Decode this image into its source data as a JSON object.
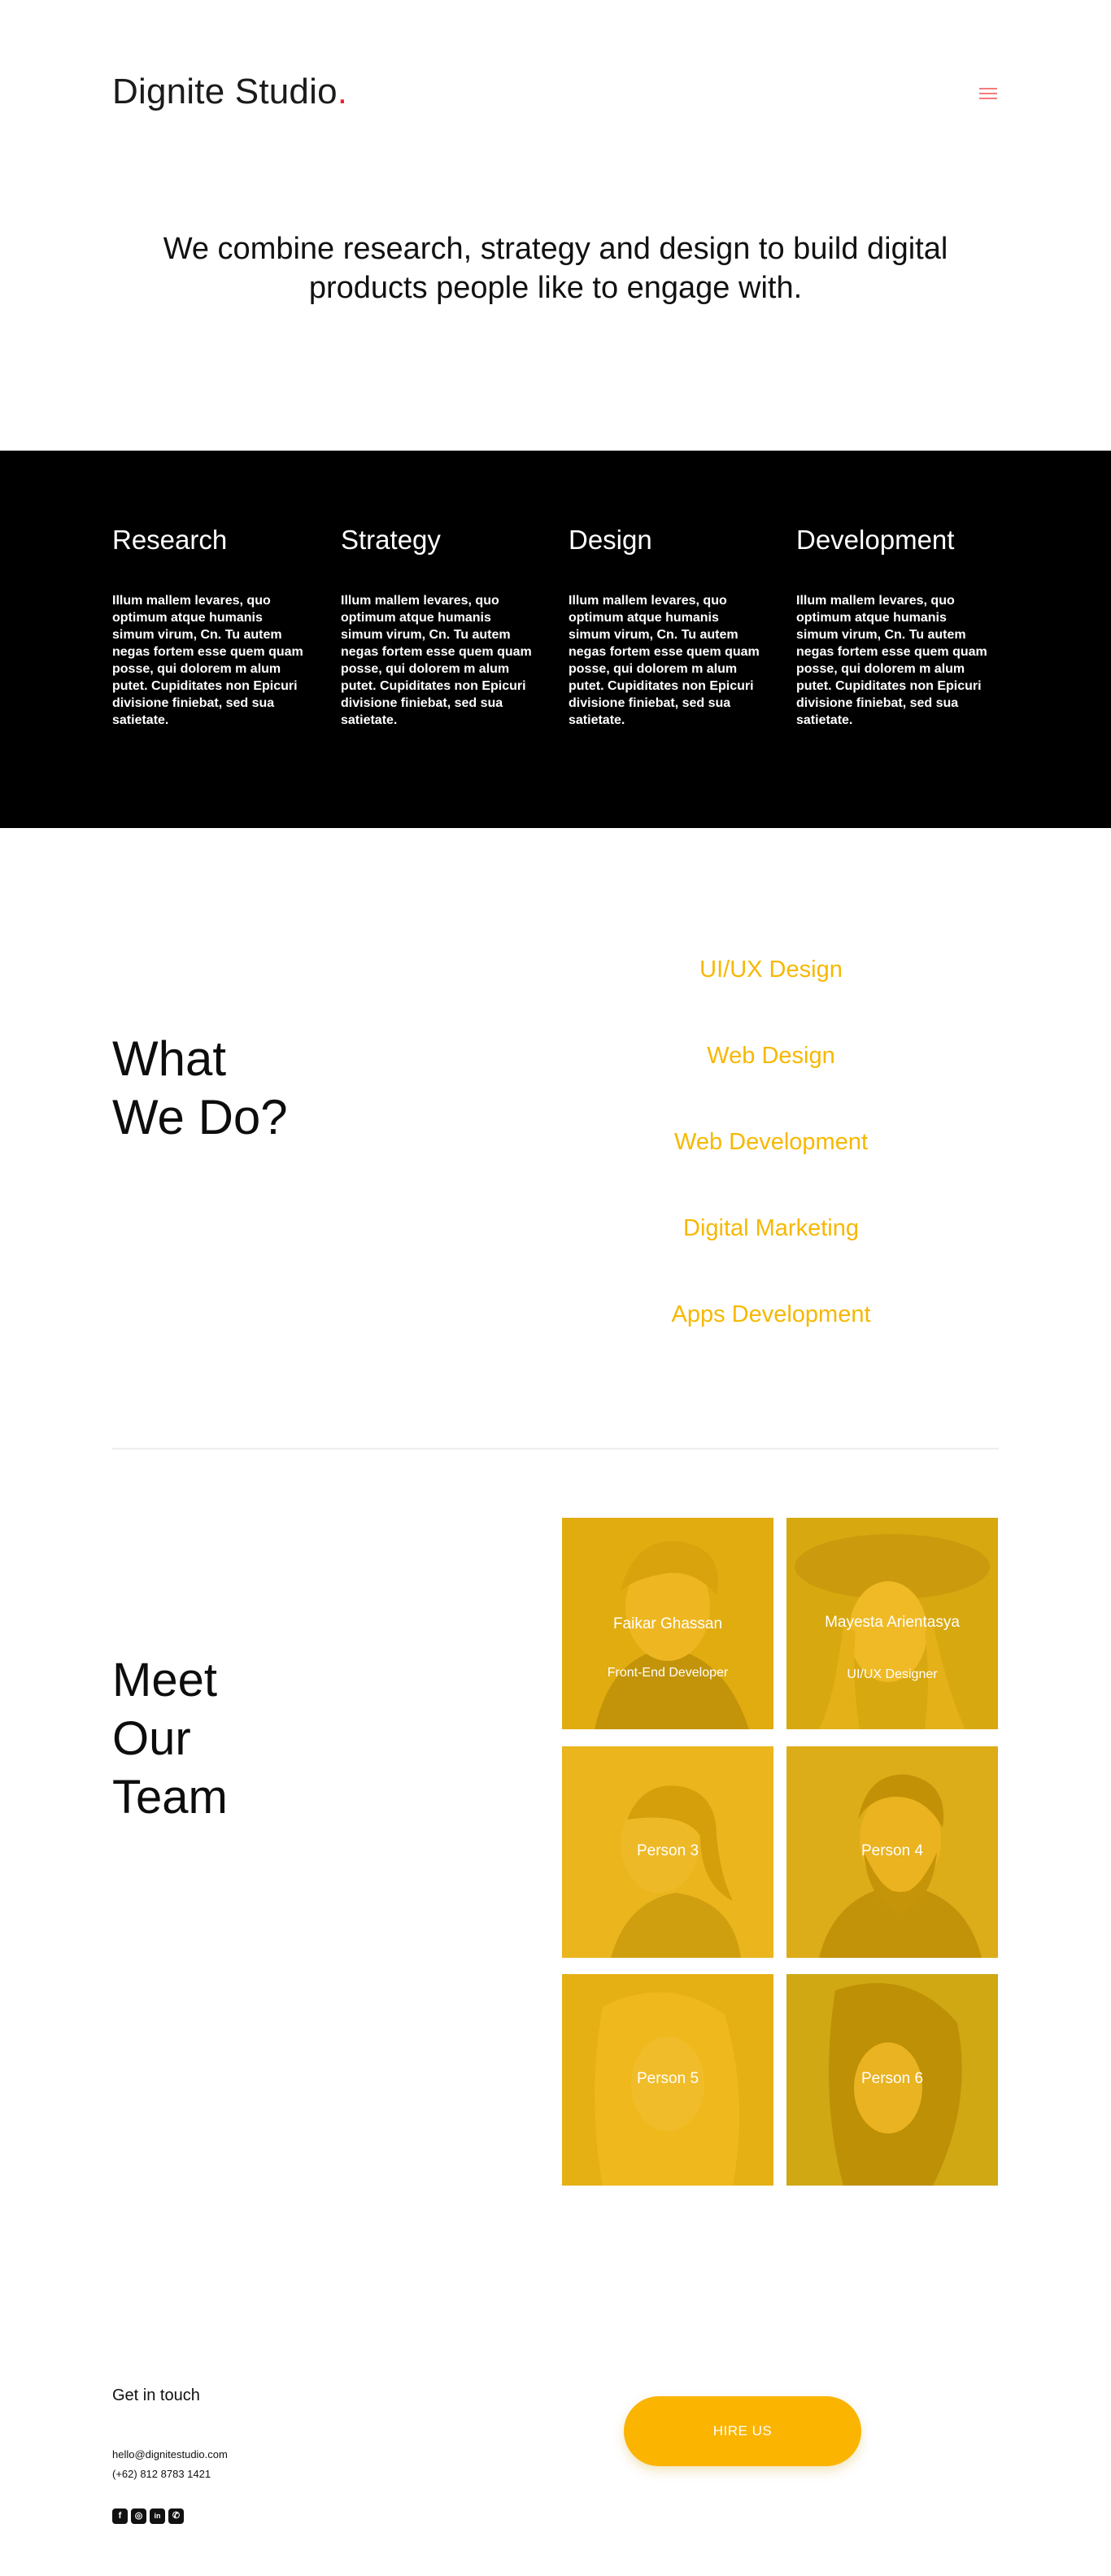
{
  "header": {
    "logo_text": "Dignite Studio",
    "logo_dot": ".",
    "menu_icon": "hamburger-menu-icon",
    "hero_text": "We combine research, strategy and design to build digital products people like to engage with."
  },
  "process": [
    {
      "title": "Research",
      "text": "Illum mallem levares, quo optimum atque humanis simum virum, Cn. Tu autem negas fortem esse quem quam posse, qui dolorem m alum putet. Cupiditates non Epicuri divisione finiebat, sed sua satietate."
    },
    {
      "title": "Strategy",
      "text": "Illum mallem levares, quo optimum atque humanis simum virum, Cn. Tu autem negas fortem esse quem quam posse, qui dolorem m alum putet. Cupiditates non Epicuri divisione finiebat, sed sua satietate."
    },
    {
      "title": "Design",
      "text": "Illum mallem levares, quo optimum atque humanis simum virum, Cn. Tu autem negas fortem esse quem quam posse, qui dolorem m alum putet. Cupiditates non Epicuri divisione finiebat, sed sua satietate."
    },
    {
      "title": "Development",
      "text": "Illum mallem levares, quo optimum atque humanis simum virum, Cn. Tu autem negas fortem esse quem quam posse, qui dolorem m alum putet. Cupiditates non Epicuri divisione finiebat, sed sua satietate."
    }
  ],
  "what_we_do": {
    "title_line1": "What",
    "title_line2": "We Do?",
    "services": [
      "UI/UX Design",
      "Web Design",
      "Web Development",
      "Digital Marketing",
      "Apps Development"
    ],
    "accent_color": "#f6b800"
  },
  "team": {
    "title_line1": "Meet",
    "title_line2": "Our",
    "title_line3": "Team",
    "overlay_color": "#f6ba00",
    "members": [
      {
        "name": "Faikar Ghassan",
        "role": "Front-End Developer"
      },
      {
        "name": "Mayesta Arientasya",
        "role": "UI/UX Designer"
      },
      {
        "name": "Person 3",
        "role": ""
      },
      {
        "name": "Person 4",
        "role": ""
      },
      {
        "name": "Person 5",
        "role": ""
      },
      {
        "name": "Person 6",
        "role": ""
      }
    ]
  },
  "footer": {
    "get_in_touch": "Get in touch",
    "email": "hello@dignitestudio.com",
    "phone": "(+62) 812 8783 1421",
    "socials": [
      {
        "icon": "facebook-icon",
        "glyph": "f"
      },
      {
        "icon": "instagram-icon",
        "glyph": "◎"
      },
      {
        "icon": "linkedin-icon",
        "glyph": "in"
      },
      {
        "icon": "whatsapp-icon",
        "glyph": "✆"
      }
    ],
    "hire_label": "HIRE US",
    "hire_color": "#fbb400"
  }
}
